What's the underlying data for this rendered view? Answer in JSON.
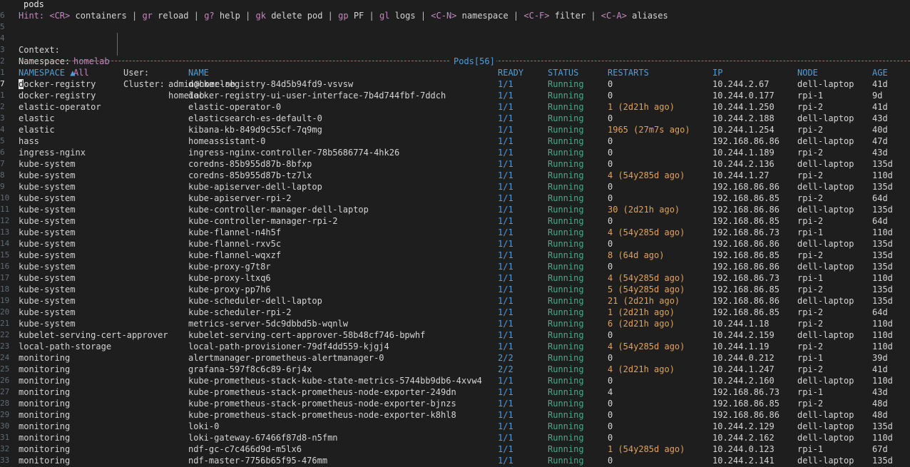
{
  "title": "pods",
  "hint": {
    "prefix": "Hint:",
    "items": [
      {
        "key": "<CR>",
        "label": "containers"
      },
      {
        "key": "gr",
        "label": "reload"
      },
      {
        "key": "g?",
        "label": "help"
      },
      {
        "key": "gk",
        "label": "delete pod"
      },
      {
        "key": "gp",
        "label": "PF"
      },
      {
        "key": "gl",
        "label": "logs"
      },
      {
        "key": "<C-N>",
        "label": "namespace"
      },
      {
        "key": "<C-F>",
        "label": "filter"
      },
      {
        "key": "<C-A>",
        "label": "aliases"
      }
    ],
    "separator": "|"
  },
  "context": {
    "context_label": "Context:",
    "context_value": "homelab",
    "namespace_label": "Namespace:",
    "namespace_value": "All",
    "user_label": "User:",
    "user_value": "admin@homelab",
    "cluster_label": "Cluster:",
    "cluster_value": "homelab"
  },
  "section_label": "Pods[56]",
  "line_numbers": {
    "title": "",
    "hint": "6",
    "blank": "5",
    "context": "4",
    "namespace": "3",
    "rule": "2",
    "header": "1"
  },
  "columns": [
    "NAMESPACE ▲",
    "NAME",
    "READY",
    "STATUS",
    "RESTARTS",
    "IP",
    "NODE",
    "AGE"
  ],
  "rows": [
    {
      "ln": "7",
      "ns": "docker-registry",
      "name": "docker-registry-84d5b94fd9-vsvsw",
      "ready": "1/1",
      "status": "Running",
      "restarts": "0",
      "ip": "10.244.2.67",
      "node": "dell-laptop",
      "age": "41d"
    },
    {
      "ln": "1",
      "ns": "docker-registry",
      "name": "docker-registry-ui-user-interface-7b4d744fbf-7ddch",
      "ready": "1/1",
      "status": "Running",
      "restarts": "0",
      "ip": "10.244.0.177",
      "node": "rpi-1",
      "age": "9d"
    },
    {
      "ln": "2",
      "ns": "elastic-operator",
      "name": "elastic-operator-0",
      "ready": "1/1",
      "status": "Running",
      "restarts": "1 (2d21h ago)",
      "ip": "10.244.1.250",
      "node": "rpi-2",
      "age": "41d"
    },
    {
      "ln": "3",
      "ns": "elastic",
      "name": "elasticsearch-es-default-0",
      "ready": "1/1",
      "status": "Running",
      "restarts": "0",
      "ip": "10.244.2.188",
      "node": "dell-laptop",
      "age": "43d"
    },
    {
      "ln": "4",
      "ns": "elastic",
      "name": "kibana-kb-849d9c55cf-7q9mg",
      "ready": "1/1",
      "status": "Running",
      "restarts": "1965 (27m7s ago)",
      "ip": "10.244.1.254",
      "node": "rpi-2",
      "age": "40d"
    },
    {
      "ln": "5",
      "ns": "hass",
      "name": "homeassistant-0",
      "ready": "1/1",
      "status": "Running",
      "restarts": "0",
      "ip": "192.168.86.86",
      "node": "dell-laptop",
      "age": "47d"
    },
    {
      "ln": "6",
      "ns": "ingress-nginx",
      "name": "ingress-nginx-controller-78b5686774-4hk26",
      "ready": "1/1",
      "status": "Running",
      "restarts": "0",
      "ip": "10.244.1.189",
      "node": "rpi-2",
      "age": "43d"
    },
    {
      "ln": "7",
      "ns": "kube-system",
      "name": "coredns-85b955d87b-8bfxp",
      "ready": "1/1",
      "status": "Running",
      "restarts": "0",
      "ip": "10.244.2.136",
      "node": "dell-laptop",
      "age": "135d"
    },
    {
      "ln": "8",
      "ns": "kube-system",
      "name": "coredns-85b955d87b-tz7lx",
      "ready": "1/1",
      "status": "Running",
      "restarts": "4 (54y285d ago)",
      "ip": "10.244.1.27",
      "node": "rpi-2",
      "age": "110d"
    },
    {
      "ln": "9",
      "ns": "kube-system",
      "name": "kube-apiserver-dell-laptop",
      "ready": "1/1",
      "status": "Running",
      "restarts": "0",
      "ip": "192.168.86.86",
      "node": "dell-laptop",
      "age": "135d"
    },
    {
      "ln": "10",
      "ns": "kube-system",
      "name": "kube-apiserver-rpi-2",
      "ready": "1/1",
      "status": "Running",
      "restarts": "0",
      "ip": "192.168.86.85",
      "node": "rpi-2",
      "age": "64d"
    },
    {
      "ln": "11",
      "ns": "kube-system",
      "name": "kube-controller-manager-dell-laptop",
      "ready": "1/1",
      "status": "Running",
      "restarts": "30 (2d21h ago)",
      "ip": "192.168.86.86",
      "node": "dell-laptop",
      "age": "135d"
    },
    {
      "ln": "12",
      "ns": "kube-system",
      "name": "kube-controller-manager-rpi-2",
      "ready": "1/1",
      "status": "Running",
      "restarts": "0",
      "ip": "192.168.86.85",
      "node": "rpi-2",
      "age": "64d"
    },
    {
      "ln": "13",
      "ns": "kube-system",
      "name": "kube-flannel-n4h5f",
      "ready": "1/1",
      "status": "Running",
      "restarts": "4 (54y285d ago)",
      "ip": "192.168.86.73",
      "node": "rpi-1",
      "age": "110d"
    },
    {
      "ln": "14",
      "ns": "kube-system",
      "name": "kube-flannel-rxv5c",
      "ready": "1/1",
      "status": "Running",
      "restarts": "0",
      "ip": "192.168.86.86",
      "node": "dell-laptop",
      "age": "135d"
    },
    {
      "ln": "15",
      "ns": "kube-system",
      "name": "kube-flannel-wqxzf",
      "ready": "1/1",
      "status": "Running",
      "restarts": "8 (64d ago)",
      "ip": "192.168.86.85",
      "node": "rpi-2",
      "age": "135d"
    },
    {
      "ln": "16",
      "ns": "kube-system",
      "name": "kube-proxy-g7t8r",
      "ready": "1/1",
      "status": "Running",
      "restarts": "0",
      "ip": "192.168.86.86",
      "node": "dell-laptop",
      "age": "135d"
    },
    {
      "ln": "17",
      "ns": "kube-system",
      "name": "kube-proxy-ltxq6",
      "ready": "1/1",
      "status": "Running",
      "restarts": "4 (54y285d ago)",
      "ip": "192.168.86.73",
      "node": "rpi-1",
      "age": "110d"
    },
    {
      "ln": "18",
      "ns": "kube-system",
      "name": "kube-proxy-pp7h6",
      "ready": "1/1",
      "status": "Running",
      "restarts": "5 (54y285d ago)",
      "ip": "192.168.86.85",
      "node": "rpi-2",
      "age": "135d"
    },
    {
      "ln": "19",
      "ns": "kube-system",
      "name": "kube-scheduler-dell-laptop",
      "ready": "1/1",
      "status": "Running",
      "restarts": "21 (2d21h ago)",
      "ip": "192.168.86.86",
      "node": "dell-laptop",
      "age": "135d"
    },
    {
      "ln": "20",
      "ns": "kube-system",
      "name": "kube-scheduler-rpi-2",
      "ready": "1/1",
      "status": "Running",
      "restarts": "1 (2d21h ago)",
      "ip": "192.168.86.85",
      "node": "rpi-2",
      "age": "64d"
    },
    {
      "ln": "21",
      "ns": "kube-system",
      "name": "metrics-server-5dc9dbbd5b-wqnlw",
      "ready": "1/1",
      "status": "Running",
      "restarts": "6 (2d21h ago)",
      "ip": "10.244.1.18",
      "node": "rpi-2",
      "age": "110d"
    },
    {
      "ln": "22",
      "ns": "kubelet-serving-cert-approver",
      "name": "kubelet-serving-cert-approver-58b48cf746-bpwhf",
      "ready": "1/1",
      "status": "Running",
      "restarts": "0",
      "ip": "10.244.2.159",
      "node": "dell-laptop",
      "age": "110d"
    },
    {
      "ln": "23",
      "ns": "local-path-storage",
      "name": "local-path-provisioner-79df4dd559-kjgj4",
      "ready": "1/1",
      "status": "Running",
      "restarts": "4 (54y285d ago)",
      "ip": "10.244.1.19",
      "node": "rpi-2",
      "age": "110d"
    },
    {
      "ln": "24",
      "ns": "monitoring",
      "name": "alertmanager-prometheus-alertmanager-0",
      "ready": "2/2",
      "status": "Running",
      "restarts": "0",
      "ip": "10.244.0.212",
      "node": "rpi-1",
      "age": "39d"
    },
    {
      "ln": "25",
      "ns": "monitoring",
      "name": "grafana-597f8c6c89-6rj4x",
      "ready": "2/2",
      "status": "Running",
      "restarts": "4 (2d21h ago)",
      "ip": "10.244.1.247",
      "node": "rpi-2",
      "age": "41d"
    },
    {
      "ln": "26",
      "ns": "monitoring",
      "name": "kube-prometheus-stack-kube-state-metrics-5744bb9db6-4xvw4",
      "ready": "1/1",
      "status": "Running",
      "restarts": "0",
      "ip": "10.244.2.160",
      "node": "dell-laptop",
      "age": "110d"
    },
    {
      "ln": "27",
      "ns": "monitoring",
      "name": "kube-prometheus-stack-prometheus-node-exporter-249dn",
      "ready": "1/1",
      "status": "Running",
      "restarts": "4",
      "ip": "192.168.86.73",
      "node": "rpi-1",
      "age": "43d"
    },
    {
      "ln": "28",
      "ns": "monitoring",
      "name": "kube-prometheus-stack-prometheus-node-exporter-bjnzs",
      "ready": "1/1",
      "status": "Running",
      "restarts": "0",
      "ip": "192.168.86.85",
      "node": "rpi-2",
      "age": "48d"
    },
    {
      "ln": "29",
      "ns": "monitoring",
      "name": "kube-prometheus-stack-prometheus-node-exporter-k8hl8",
      "ready": "1/1",
      "status": "Running",
      "restarts": "0",
      "ip": "192.168.86.86",
      "node": "dell-laptop",
      "age": "48d"
    },
    {
      "ln": "30",
      "ns": "monitoring",
      "name": "loki-0",
      "ready": "1/1",
      "status": "Running",
      "restarts": "0",
      "ip": "10.244.2.129",
      "node": "dell-laptop",
      "age": "135d"
    },
    {
      "ln": "31",
      "ns": "monitoring",
      "name": "loki-gateway-67466f87d8-n5fmn",
      "ready": "1/1",
      "status": "Running",
      "restarts": "0",
      "ip": "10.244.2.162",
      "node": "dell-laptop",
      "age": "110d"
    },
    {
      "ln": "32",
      "ns": "monitoring",
      "name": "ndf-gc-c7c466d9d-m5lx6",
      "ready": "1/1",
      "status": "Running",
      "restarts": "1 (54y285d ago)",
      "ip": "10.244.0.123",
      "node": "rpi-1",
      "age": "67d"
    },
    {
      "ln": "33",
      "ns": "monitoring",
      "name": "ndf-master-7756b65f95-476mm",
      "ready": "1/1",
      "status": "Running",
      "restarts": "0",
      "ip": "10.244.2.141",
      "node": "dell-laptop",
      "age": "135d"
    }
  ]
}
